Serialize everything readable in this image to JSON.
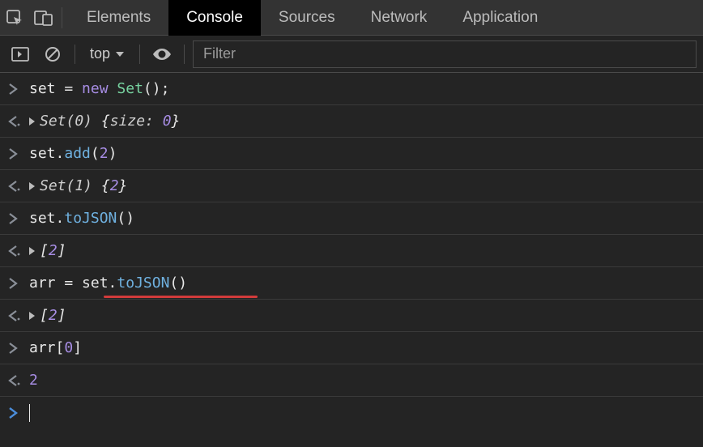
{
  "tabs": {
    "elements": "Elements",
    "console": "Console",
    "sources": "Sources",
    "network": "Network",
    "application": "Application"
  },
  "toolbar": {
    "context": "top",
    "filter_placeholder": "Filter"
  },
  "console": {
    "rows": [
      {
        "kind": "input",
        "tokens": [
          {
            "t": "id",
            "v": "set"
          },
          {
            "t": "op",
            "v": " = "
          },
          {
            "t": "kw",
            "v": "new"
          },
          {
            "t": "op",
            "v": " "
          },
          {
            "t": "type",
            "v": "Set"
          },
          {
            "t": "paren",
            "v": "()"
          },
          {
            "t": "op",
            "v": ";"
          }
        ]
      },
      {
        "kind": "output",
        "disclose": true,
        "tokens": [
          {
            "t": "repr",
            "v": "Set(0) "
          },
          {
            "t": "brace",
            "v": "{"
          },
          {
            "t": "repr",
            "v": "size: "
          },
          {
            "t": "num",
            "v": "0",
            "italic": true
          },
          {
            "t": "brace",
            "v": "}"
          }
        ]
      },
      {
        "kind": "input",
        "tokens": [
          {
            "t": "id",
            "v": "set"
          },
          {
            "t": "op",
            "v": "."
          },
          {
            "t": "method",
            "v": "add"
          },
          {
            "t": "paren",
            "v": "("
          },
          {
            "t": "num",
            "v": "2"
          },
          {
            "t": "paren",
            "v": ")"
          }
        ]
      },
      {
        "kind": "output",
        "disclose": true,
        "tokens": [
          {
            "t": "repr",
            "v": "Set(1) "
          },
          {
            "t": "brace",
            "v": "{"
          },
          {
            "t": "num",
            "v": "2",
            "italic": true
          },
          {
            "t": "brace",
            "v": "}"
          }
        ]
      },
      {
        "kind": "input",
        "tokens": [
          {
            "t": "id",
            "v": "set"
          },
          {
            "t": "op",
            "v": "."
          },
          {
            "t": "method",
            "v": "toJSON"
          },
          {
            "t": "paren",
            "v": "()"
          }
        ]
      },
      {
        "kind": "output",
        "disclose": true,
        "tokens": [
          {
            "t": "brace",
            "v": "["
          },
          {
            "t": "num",
            "v": "2",
            "italic": true
          },
          {
            "t": "brace",
            "v": "]"
          }
        ]
      },
      {
        "kind": "input",
        "underline": true,
        "tokens": [
          {
            "t": "id",
            "v": "arr"
          },
          {
            "t": "op",
            "v": " = "
          },
          {
            "t": "id",
            "v": "set"
          },
          {
            "t": "op",
            "v": "."
          },
          {
            "t": "method",
            "v": "toJSON"
          },
          {
            "t": "paren",
            "v": "()"
          }
        ]
      },
      {
        "kind": "output",
        "disclose": true,
        "tokens": [
          {
            "t": "brace",
            "v": "["
          },
          {
            "t": "num",
            "v": "2",
            "italic": true
          },
          {
            "t": "brace",
            "v": "]"
          }
        ]
      },
      {
        "kind": "input",
        "tokens": [
          {
            "t": "id",
            "v": "arr"
          },
          {
            "t": "paren",
            "v": "["
          },
          {
            "t": "num",
            "v": "0"
          },
          {
            "t": "paren",
            "v": "]"
          }
        ]
      },
      {
        "kind": "output",
        "tokens": [
          {
            "t": "num",
            "v": "2"
          }
        ]
      },
      {
        "kind": "prompt"
      }
    ]
  },
  "icons": {
    "inspect": "inspect-icon",
    "device": "device-toggle-icon",
    "play": "play-icon",
    "clear": "clear-icon",
    "eye": "eye-icon",
    "dropdown": "chevron-down-icon"
  }
}
